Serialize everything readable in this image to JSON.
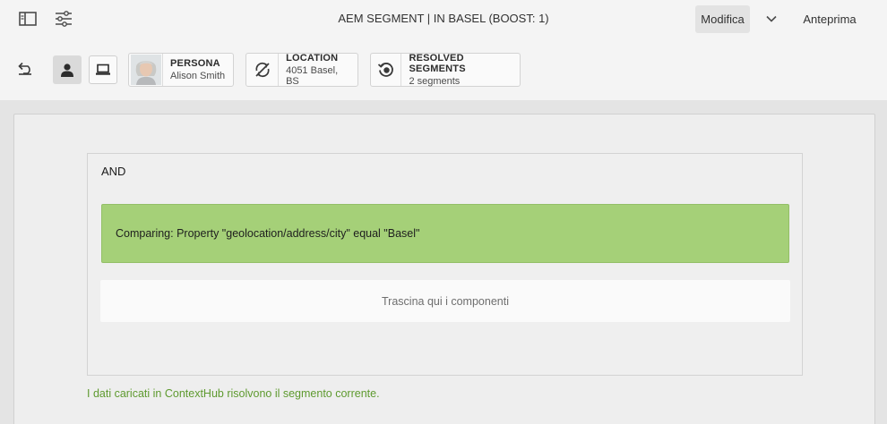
{
  "header": {
    "title": "AEM SEGMENT | IN BASEL (BOOST: 1)",
    "edit_label": "Modifica",
    "preview_label": "Anteprima"
  },
  "toolbar": {
    "persona": {
      "label": "PERSONA",
      "value": "Alison Smith"
    },
    "location": {
      "label": "LOCATION",
      "value": "4051 Basel, BS"
    },
    "resolved": {
      "label": "RESOLVED SEGMENTS",
      "value": "2 segments"
    }
  },
  "editor": {
    "container_label": "AND",
    "condition_text": "Comparing: Property \"geolocation/address/city\" equal  \"Basel\"",
    "drop_zone_text": "Trascina qui i componenti",
    "status_message": "I dati caricati in ContextHub risolvono il segmento corrente."
  },
  "colors": {
    "condition_green": "#a5d078",
    "status_green": "#5e9a2f",
    "toolbar_bg": "#f4f4f4",
    "canvas_bg": "#e4e4e4"
  }
}
